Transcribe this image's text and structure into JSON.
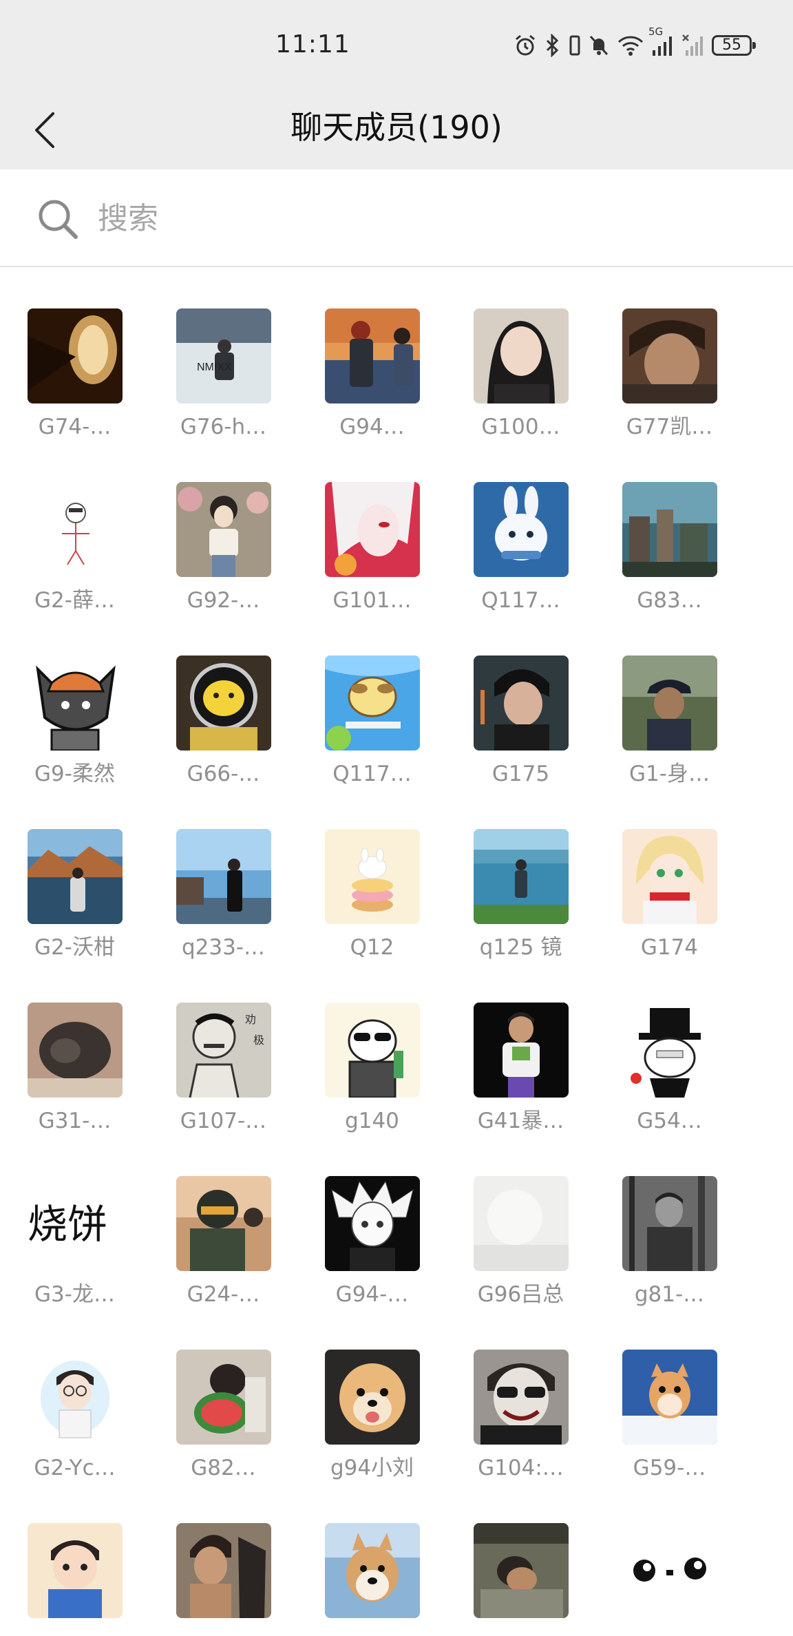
{
  "status_bar": {
    "time": "11:11",
    "battery": "55",
    "network": "5G",
    "icons": [
      "alarm-icon",
      "bluetooth-icon",
      "mute-icon",
      "wifi-icon",
      "signal-icon",
      "signal-no-sim-icon",
      "battery-icon"
    ]
  },
  "header": {
    "title": "聊天成员(190)",
    "back_icon": "chevron-left-icon"
  },
  "search": {
    "placeholder": "搜索",
    "value": ""
  },
  "colors": {
    "header_background": "#ededed",
    "name_text": "#8f8f8f",
    "placeholder_text": "#a7a7a7"
  },
  "members": [
    {
      "name": "G74-…",
      "avatar": "airplane-window"
    },
    {
      "name": "G76-h…",
      "avatar": "snow-figure"
    },
    {
      "name": "G94…",
      "avatar": "couple-sunset"
    },
    {
      "name": "G100…",
      "avatar": "girl-portrait"
    },
    {
      "name": "G77凯…",
      "avatar": "man-portrait"
    },
    {
      "name": "G2-薛…",
      "avatar": "doodle-person"
    },
    {
      "name": "G92-…",
      "avatar": "anime-girl-garden"
    },
    {
      "name": "G101…",
      "avatar": "anime-white-hair"
    },
    {
      "name": "Q117…",
      "avatar": "white-rabbit"
    },
    {
      "name": "G83…",
      "avatar": "anime-cityscape"
    },
    {
      "name": "G9-柔然",
      "avatar": "cartoon-cat-cap"
    },
    {
      "name": "G66-…",
      "avatar": "pikachu-astronaut"
    },
    {
      "name": "Q117…",
      "avatar": "pompompurin-swing"
    },
    {
      "name": "G175",
      "avatar": "anime-boy-dark"
    },
    {
      "name": "G1-身…",
      "avatar": "man-with-cap"
    },
    {
      "name": "G2-沃柑",
      "avatar": "lake-mountains"
    },
    {
      "name": "q233-…",
      "avatar": "man-seaside"
    },
    {
      "name": "Q12",
      "avatar": "donut-bunny"
    },
    {
      "name": "q125 镜",
      "avatar": "lake-figure"
    },
    {
      "name": "G174",
      "avatar": "anime-blonde-girl"
    },
    {
      "name": "G31-…",
      "avatar": "sleeping-pug"
    },
    {
      "name": "G107-…",
      "avatar": "sketch-man"
    },
    {
      "name": "g140",
      "avatar": "panda-meme"
    },
    {
      "name": "G41暴…",
      "avatar": "buzz-kid"
    },
    {
      "name": "G54…",
      "avatar": "top-hat-meme"
    },
    {
      "name": "G3-龙…",
      "avatar": "calligraphy"
    },
    {
      "name": "G24-…",
      "avatar": "helmet-rider"
    },
    {
      "name": "G94-…",
      "avatar": "anime-killua"
    },
    {
      "name": "G96吕总",
      "avatar": "blurred-light"
    },
    {
      "name": "g81-…",
      "avatar": "forest-man-bw"
    },
    {
      "name": "G2-Yc…",
      "avatar": "cartoon-glasses"
    },
    {
      "name": "G82…",
      "avatar": "watermelon-eater"
    },
    {
      "name": "g94小刘",
      "avatar": "pomeranian-dog"
    },
    {
      "name": "G104:…",
      "avatar": "joker-glasses"
    },
    {
      "name": "G59-…",
      "avatar": "cat-in-snow"
    },
    {
      "name": "",
      "avatar": "cartoon-boy"
    },
    {
      "name": "",
      "avatar": "anime-man-horse"
    },
    {
      "name": "",
      "avatar": "shiba-dog"
    },
    {
      "name": "",
      "avatar": "man-resting"
    },
    {
      "name": "",
      "avatar": "eyes-doodle"
    }
  ]
}
